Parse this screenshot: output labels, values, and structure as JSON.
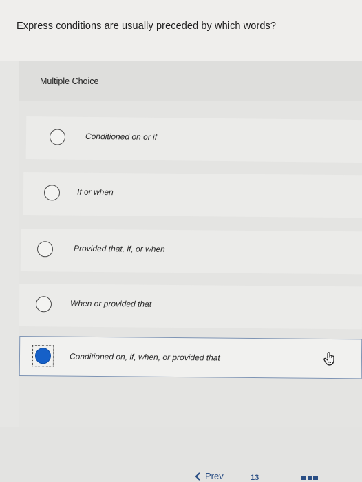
{
  "question": {
    "text": "Express conditions are usually preceded by which words?"
  },
  "question_type": {
    "label": "Multiple Choice"
  },
  "options": [
    {
      "label": "Conditioned on or if",
      "selected": false
    },
    {
      "label": "If or when",
      "selected": false
    },
    {
      "label": "Provided that, if, or when",
      "selected": false
    },
    {
      "label": "When or provided that",
      "selected": false
    },
    {
      "label": "Conditioned on, if, when, or provided that",
      "selected": true
    }
  ],
  "navigation": {
    "prev_label": "Prev",
    "page_indicator": "13",
    "prev_icon": "chevron-left-icon",
    "cursor_icon": "hand-pointer-icon"
  },
  "colors": {
    "selected_radio": "#1560c8",
    "link": "#2b4f85",
    "selected_border": "#7e94b4"
  }
}
